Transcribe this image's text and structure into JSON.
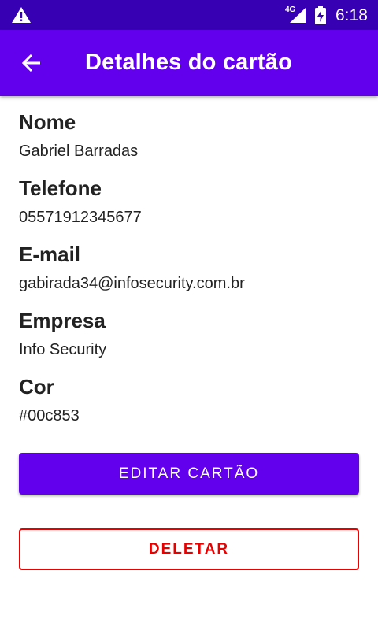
{
  "status_bar": {
    "warning_icon": "warning-icon",
    "network": "4G",
    "time": "6:18"
  },
  "app_bar": {
    "back_icon": "arrow-back-icon",
    "title": "Detalhes do cartão"
  },
  "details": [
    {
      "label": "Nome",
      "value": "Gabriel Barradas"
    },
    {
      "label": "Telefone",
      "value": "05571912345677"
    },
    {
      "label": "E-mail",
      "value": "gabirada34@infosecurity.com.br"
    },
    {
      "label": "Empresa",
      "value": "Info Security"
    },
    {
      "label": "Cor",
      "value": "#00c853"
    }
  ],
  "actions": {
    "edit_label": "EDITAR CARTÃO",
    "delete_label": "DELETAR"
  },
  "colors": {
    "status_bar": "#3700b3",
    "primary": "#6200ee",
    "danger": "#e60000"
  }
}
